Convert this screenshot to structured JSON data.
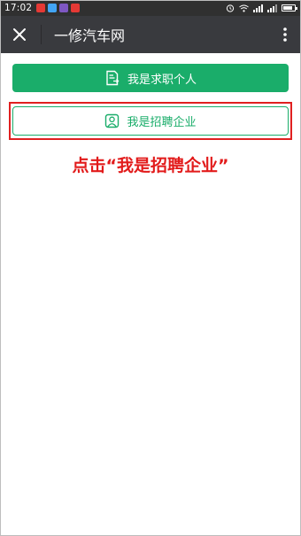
{
  "status_bar": {
    "time": "17:02",
    "notification_icons": [
      {
        "icon": "app-notification-icon",
        "color": "#e53935"
      },
      {
        "icon": "app-notification-icon",
        "color": "#42a5f5"
      },
      {
        "icon": "app-notification-icon",
        "color": "#7e57c2"
      },
      {
        "icon": "app-notification-icon",
        "color": "#e53935"
      }
    ],
    "battery_level": 0.85
  },
  "app_bar": {
    "title": "一修汽车网",
    "close_icon": "close-icon",
    "more_icon": "more-vert-icon"
  },
  "buttons": {
    "job_seeker_label": "我是求职个人",
    "job_seeker_icon": "resume-icon",
    "employer_label": "我是招聘企业",
    "employer_icon": "portrait-icon"
  },
  "annotation": {
    "text": "点击“我是招聘企业”"
  },
  "colors": {
    "status_bar": "#303030",
    "app_bar": "#393a3e",
    "accent_green": "#1aad6a",
    "annotation_red": "#e21b1b"
  }
}
